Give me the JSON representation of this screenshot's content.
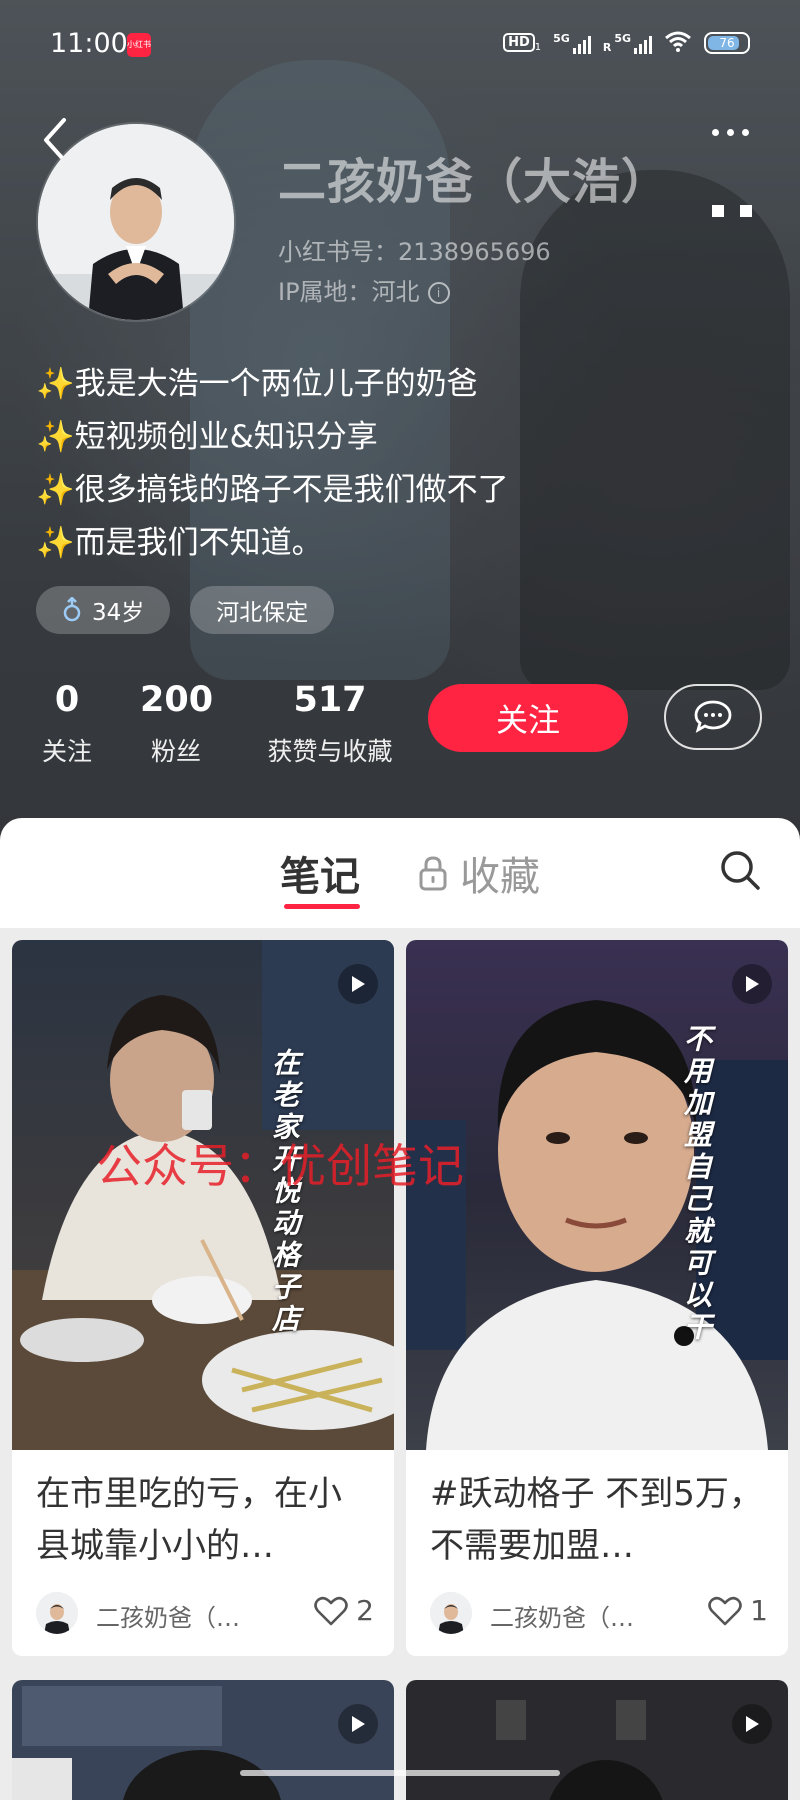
{
  "status_bar": {
    "time": "11:00",
    "app_badge": "小红书",
    "hd": "HD",
    "hd_sub": "1",
    "net1": "5G",
    "net2": "5G",
    "roaming": "R",
    "battery": "76"
  },
  "profile": {
    "name": "二孩奶爸（大浩）",
    "id_line": "小红书号：2138965696",
    "ip_line": "IP属地：河北",
    "info_icon_text": "i",
    "bio": [
      "✨我是大浩一个两位儿子的奶爸",
      "✨短视频创业&知识分享",
      "✨很多搞钱的路子不是我们做不了",
      "✨而是我们不知道。"
    ],
    "tags": [
      {
        "label": "34岁",
        "icon": "male-icon"
      },
      {
        "label": "河北保定"
      }
    ],
    "stats": [
      {
        "num": "0",
        "label": "关注"
      },
      {
        "num": "200",
        "label": "粉丝"
      },
      {
        "num": "517",
        "label": "获赞与收藏"
      }
    ],
    "follow_label": "关注"
  },
  "tabs": {
    "notes": "笔记",
    "collect": "收藏"
  },
  "feed": {
    "watermark": "公众号：优创笔记",
    "cards": [
      {
        "title": "在市里吃的亏，在小县城靠小小的…",
        "author": "二孩奶爸（…",
        "likes": "2",
        "caption": "在老家开悦动格子店"
      },
      {
        "title": "#跃动格子 不到5万，不需要加盟…",
        "author": "二孩奶爸（…",
        "likes": "1",
        "caption": "不用加盟自己就可以干"
      }
    ]
  },
  "colors": {
    "accent": "#ff2442",
    "header_bg": "#4a5156"
  }
}
